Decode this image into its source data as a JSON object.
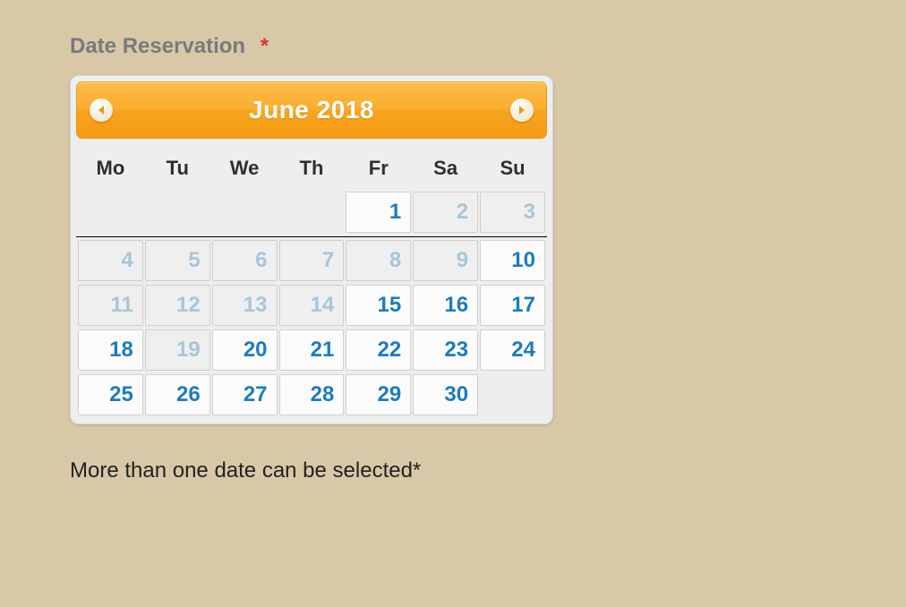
{
  "field": {
    "label": "Date Reservation",
    "required_mark": "*",
    "helper_text": "More than one date can be selected*"
  },
  "calendar": {
    "title": "June 2018",
    "weekdays": [
      "Mo",
      "Tu",
      "We",
      "Th",
      "Fr",
      "Sa",
      "Su"
    ],
    "weeks": [
      [
        {
          "day": null
        },
        {
          "day": null
        },
        {
          "day": null
        },
        {
          "day": null
        },
        {
          "day": 1,
          "enabled": true
        },
        {
          "day": 2,
          "enabled": false
        },
        {
          "day": 3,
          "enabled": false
        }
      ],
      [
        {
          "day": 4,
          "enabled": false
        },
        {
          "day": 5,
          "enabled": false
        },
        {
          "day": 6,
          "enabled": false
        },
        {
          "day": 7,
          "enabled": false
        },
        {
          "day": 8,
          "enabled": false
        },
        {
          "day": 9,
          "enabled": false
        },
        {
          "day": 10,
          "enabled": true
        }
      ],
      [
        {
          "day": 11,
          "enabled": false
        },
        {
          "day": 12,
          "enabled": false
        },
        {
          "day": 13,
          "enabled": false
        },
        {
          "day": 14,
          "enabled": false
        },
        {
          "day": 15,
          "enabled": true
        },
        {
          "day": 16,
          "enabled": true
        },
        {
          "day": 17,
          "enabled": true
        }
      ],
      [
        {
          "day": 18,
          "enabled": true
        },
        {
          "day": 19,
          "enabled": false
        },
        {
          "day": 20,
          "enabled": true
        },
        {
          "day": 21,
          "enabled": true
        },
        {
          "day": 22,
          "enabled": true
        },
        {
          "day": 23,
          "enabled": true
        },
        {
          "day": 24,
          "enabled": true
        }
      ],
      [
        {
          "day": 25,
          "enabled": true
        },
        {
          "day": 26,
          "enabled": true
        },
        {
          "day": 27,
          "enabled": true
        },
        {
          "day": 28,
          "enabled": true
        },
        {
          "day": 29,
          "enabled": true
        },
        {
          "day": 30,
          "enabled": true
        },
        {
          "day": null
        }
      ]
    ]
  }
}
